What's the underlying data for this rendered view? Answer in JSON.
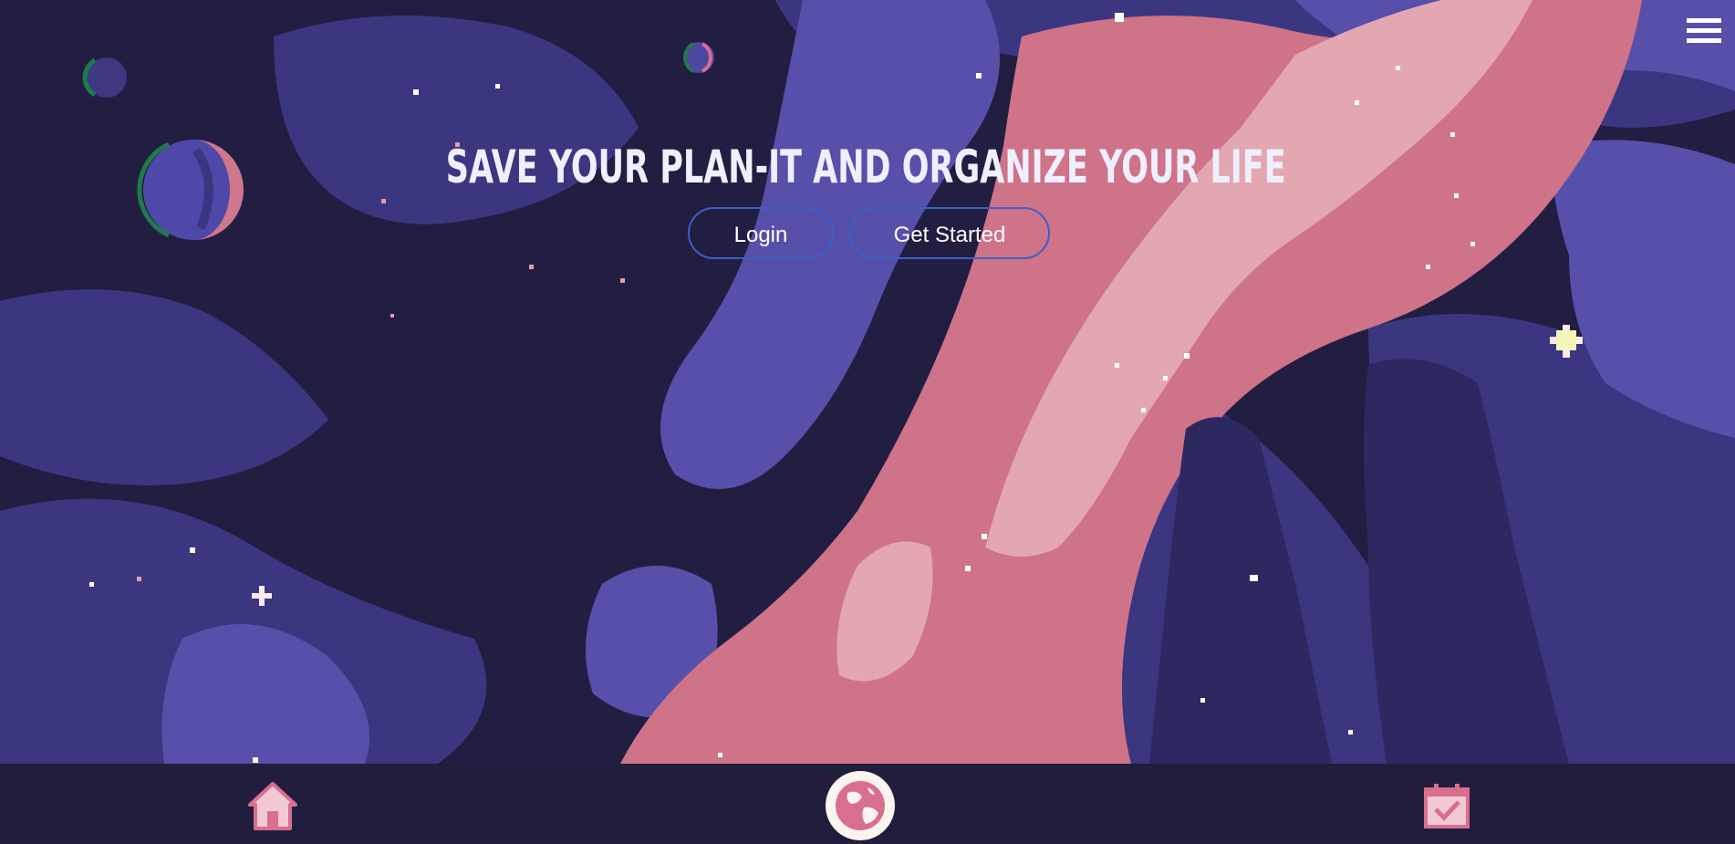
{
  "hero": {
    "headline": "SAVE YOUR PLAN-IT AND ORGANIZE YOUR LIFE",
    "login_label": "Login",
    "get_started_label": "Get Started"
  },
  "header": {
    "menu_icon": "hamburger-menu-icon"
  },
  "bottom_nav": {
    "items": [
      {
        "icon": "home-icon"
      },
      {
        "icon": "globe-icon"
      },
      {
        "icon": "calendar-check-icon"
      }
    ]
  },
  "colors": {
    "sky_dark": "#211e42",
    "nebula_purple": "#413c8a",
    "nebula_violet": "#5a53b0",
    "nebula_pink": "#d0768d",
    "nebula_light_pink": "#e5a9b3",
    "button_border": "#3d5fc8",
    "nav_bar": "#201d3d",
    "icon_pink": "#d86f8f",
    "text_light": "#eef0ff"
  }
}
